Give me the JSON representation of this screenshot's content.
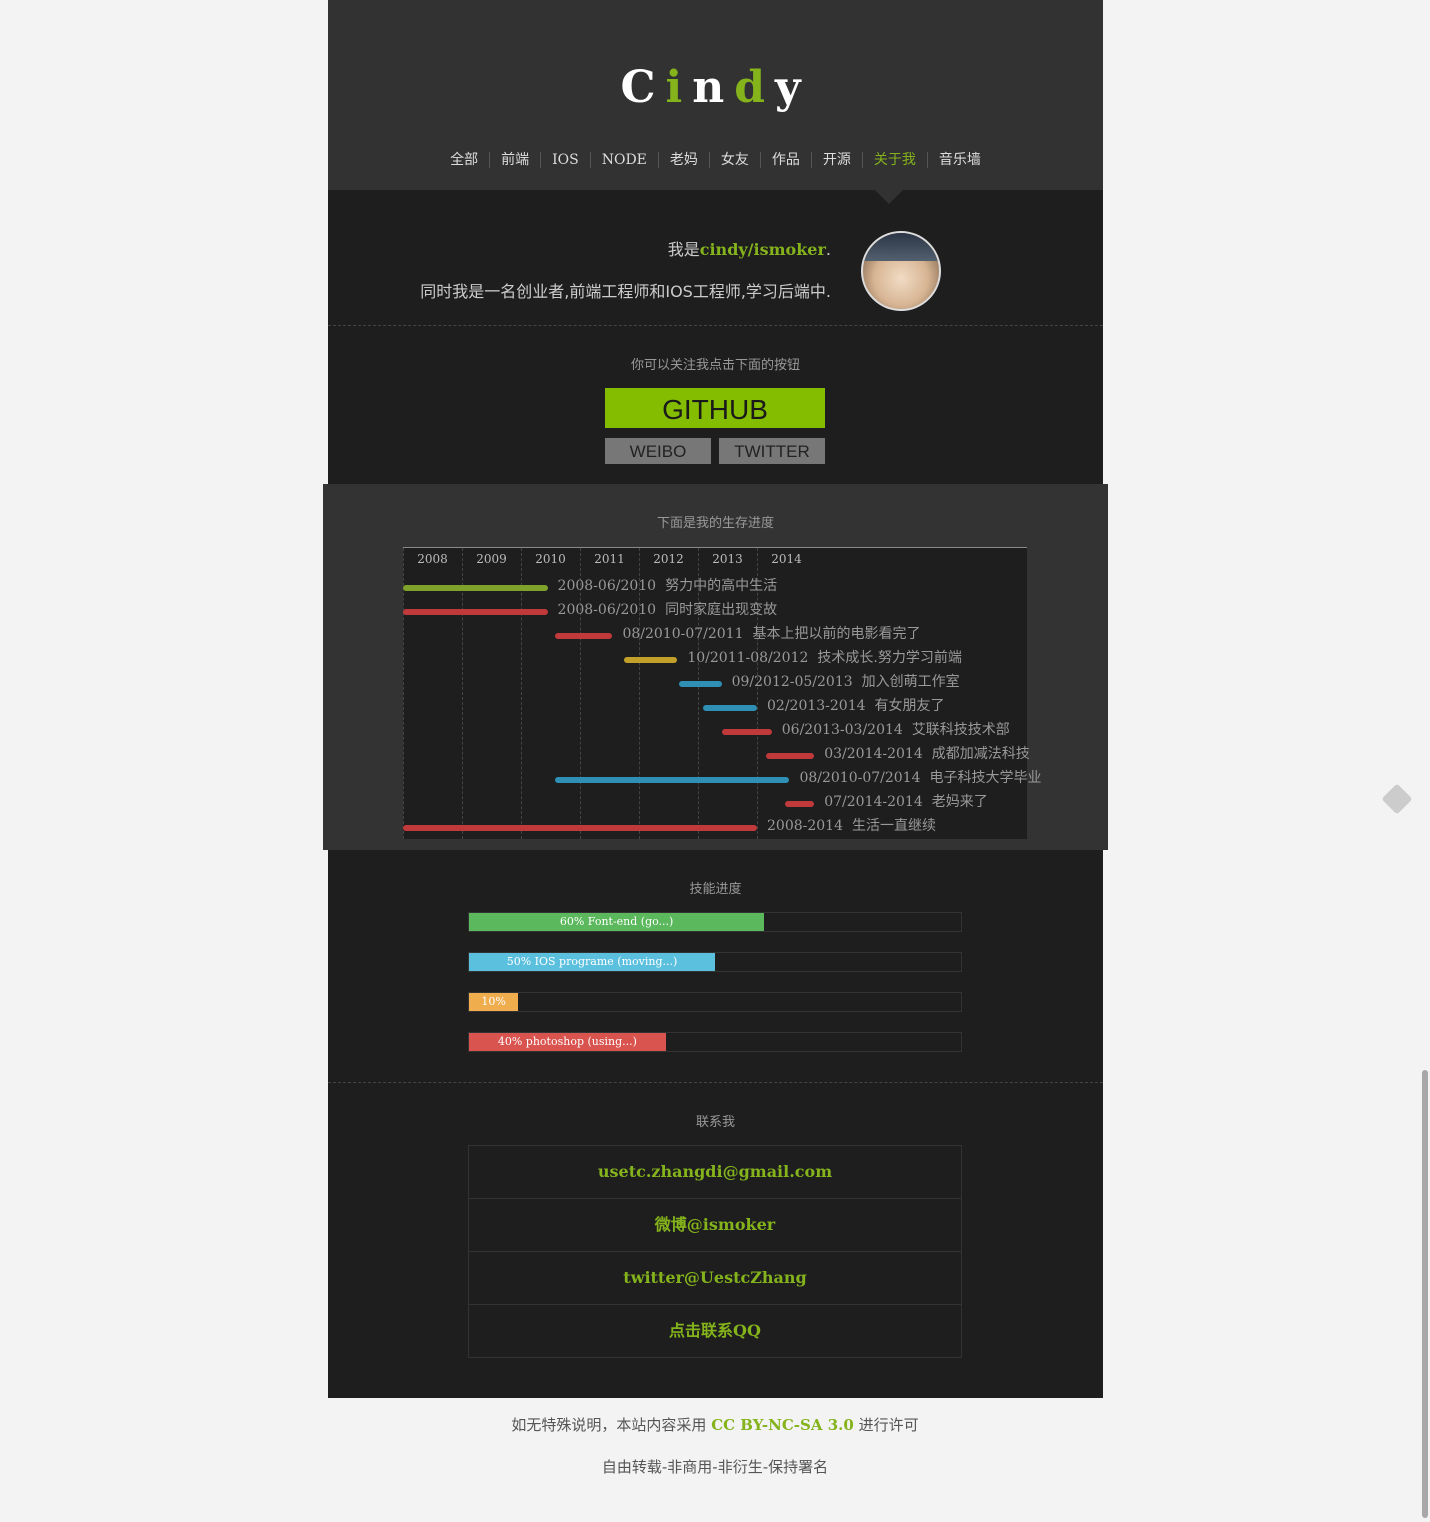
{
  "logo": {
    "c1": "C",
    "c2": "i",
    "c3": "n",
    "c4": "d",
    "c5": "y"
  },
  "nav": {
    "items": [
      "全部",
      "前端",
      "IOS",
      "NODE",
      "老妈",
      "女友",
      "作品",
      "开源",
      "关于我",
      "音乐墙"
    ],
    "active": "关于我"
  },
  "intro": {
    "prefix": "我是",
    "name": "cindy/ismoker",
    "suffix": ".",
    "line2": "同时我是一名创业者,前端工程师和IOS工程师,学习后端中."
  },
  "follow": {
    "title": "你可以关注我点击下面的按钮",
    "github": "GITHUB",
    "weibo": "WEIBO",
    "twitter": "TWITTER"
  },
  "timeline": {
    "title": "下面是我的生存进度",
    "years": [
      "2008",
      "2009",
      "2010",
      "2011",
      "2012",
      "2013",
      "2014"
    ],
    "events": [
      {
        "start": 2008.0,
        "end": 2010.45,
        "color": "#7fa32a",
        "range": "2008-06/2010",
        "text": "努力中的高中生活"
      },
      {
        "start": 2008.0,
        "end": 2010.45,
        "color": "#c0393b",
        "range": "2008-06/2010",
        "text": "同时家庭出现变故"
      },
      {
        "start": 2010.58,
        "end": 2011.55,
        "color": "#c0393b",
        "range": "08/2010-07/2011",
        "text": "基本上把以前的电影看完了"
      },
      {
        "start": 2011.75,
        "end": 2012.65,
        "color": "#c3a02a",
        "range": "10/2011-08/2012",
        "text": "技术成长.努力学习前端"
      },
      {
        "start": 2012.67,
        "end": 2013.4,
        "color": "#2f8fb5",
        "range": "09/2012-05/2013",
        "text": "加入创萌工作室"
      },
      {
        "start": 2013.08,
        "end": 2014.0,
        "color": "#2f8fb5",
        "range": "02/2013-2014",
        "text": "有女朋友了"
      },
      {
        "start": 2013.4,
        "end": 2014.25,
        "color": "#c0393b",
        "range": "06/2013-03/2014",
        "text": "艾联科技技术部"
      },
      {
        "start": 2014.15,
        "end": 2014.97,
        "color": "#c0393b",
        "range": "03/2014-2014",
        "text": "成都加减法科技"
      },
      {
        "start": 2010.58,
        "end": 2014.55,
        "color": "#2f8fb5",
        "range": "08/2010-07/2014",
        "text": "电子科技大学毕业"
      },
      {
        "start": 2014.48,
        "end": 2014.97,
        "color": "#c0393b",
        "range": "07/2014-2014",
        "text": "老妈来了"
      },
      {
        "start": 2008.0,
        "end": 2014.0,
        "color": "#c0393b",
        "range": "2008-2014",
        "text": "生活一直继续"
      }
    ]
  },
  "skills": {
    "title": "技能进度",
    "items": [
      {
        "percent": 60,
        "label": "60% Font-end (go...)",
        "color": "#5cb85c"
      },
      {
        "percent": 50,
        "label": "50% IOS programe (moving...)",
        "color": "#5bc0de"
      },
      {
        "percent": 10,
        "label": "10%",
        "color": "#f0ad4e"
      },
      {
        "percent": 40,
        "label": "40% photoshop (using...)",
        "color": "#d9534f"
      }
    ]
  },
  "contact": {
    "title": "联系我",
    "items": [
      "usetc.zhangdi@gmail.com",
      "微博@ismoker",
      "twitter@UestcZhang",
      "点击联系QQ"
    ]
  },
  "footer": {
    "pre": "如无特殊说明，本站内容采用",
    "license": "CC BY-NC-SA 3.0",
    "post": "进行许可",
    "line2": "自由转载-非商用-非衍生-保持署名"
  },
  "icons": {
    "feed": "feed-icon"
  }
}
